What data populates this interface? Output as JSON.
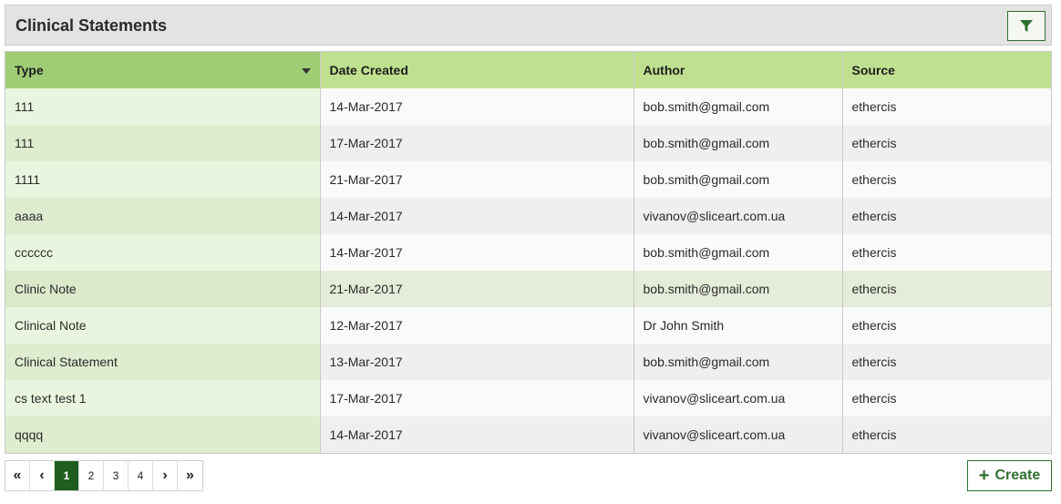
{
  "header": {
    "title": "Clinical Statements",
    "filter_icon": "filter-icon"
  },
  "table": {
    "columns": [
      "Type",
      "Date Created",
      "Author",
      "Source"
    ],
    "sorted_column": "Type",
    "rows": [
      [
        "111",
        "14-Mar-2017",
        "bob.smith@gmail.com",
        "ethercis"
      ],
      [
        "111",
        "17-Mar-2017",
        "bob.smith@gmail.com",
        "ethercis"
      ],
      [
        "1111",
        "21-Mar-2017",
        "bob.smith@gmail.com",
        "ethercis"
      ],
      [
        "aaaa",
        "14-Mar-2017",
        "vivanov@sliceart.com.ua",
        "ethercis"
      ],
      [
        "cccccc",
        "14-Mar-2017",
        "bob.smith@gmail.com",
        "ethercis"
      ],
      [
        "Clinic Note",
        "21-Mar-2017",
        "bob.smith@gmail.com",
        "ethercis"
      ],
      [
        "Clinical Note",
        "12-Mar-2017",
        "Dr John Smith",
        "ethercis"
      ],
      [
        "Clinical Statement",
        "13-Mar-2017",
        "bob.smith@gmail.com",
        "ethercis"
      ],
      [
        "cs text test 1",
        "17-Mar-2017",
        "vivanov@sliceart.com.ua",
        "ethercis"
      ],
      [
        "qqqq",
        "14-Mar-2017",
        "vivanov@sliceart.com.ua",
        "ethercis"
      ]
    ]
  },
  "pagination": {
    "first": "«",
    "prev": "‹",
    "next": "›",
    "last": "»",
    "pages": [
      "1",
      "2",
      "3",
      "4"
    ],
    "current": "1"
  },
  "create_button": {
    "label": "Create",
    "icon": "plus-icon"
  },
  "colors": {
    "accent": "#2f6f2f",
    "header_green": "#bfe08f",
    "active_page": "#1f5e1f"
  }
}
